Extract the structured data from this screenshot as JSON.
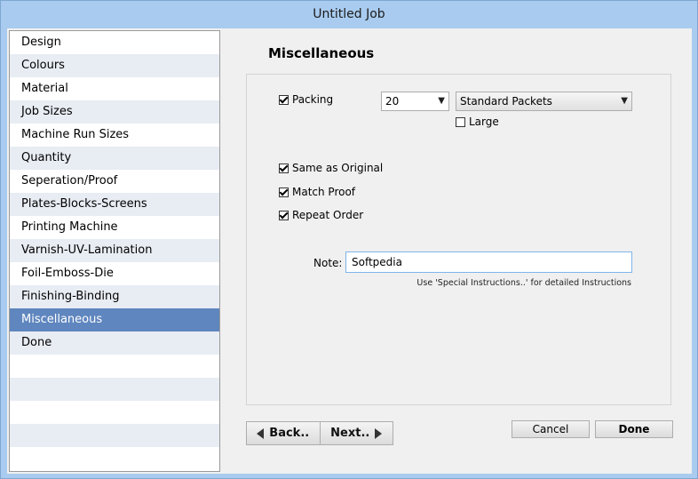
{
  "window": {
    "title": "Untitled Job"
  },
  "sidebar": {
    "items": [
      {
        "label": "Design"
      },
      {
        "label": "Colours"
      },
      {
        "label": "Material"
      },
      {
        "label": "Job Sizes"
      },
      {
        "label": "Machine Run Sizes"
      },
      {
        "label": "Quantity"
      },
      {
        "label": "Seperation/Proof"
      },
      {
        "label": "Plates-Blocks-Screens"
      },
      {
        "label": "Printing Machine"
      },
      {
        "label": "Varnish-UV-Lamination"
      },
      {
        "label": "Foil-Emboss-Die"
      },
      {
        "label": "Finishing-Binding"
      },
      {
        "label": "Miscellaneous"
      },
      {
        "label": "Done"
      }
    ],
    "selected": "Miscellaneous"
  },
  "main": {
    "title": "Miscellaneous",
    "packing": {
      "label": "Packing",
      "checked": true,
      "count": "20",
      "type": "Standard Packets"
    },
    "large": {
      "label": "Large",
      "checked": false
    },
    "same_as_original": {
      "label": "Same as Original",
      "checked": true
    },
    "match_proof": {
      "label": "Match Proof",
      "checked": true
    },
    "repeat_order": {
      "label": "Repeat Order",
      "checked": true
    },
    "note": {
      "label": "Note:",
      "value": "Softpedia",
      "hint": "Use 'Special Instructions..' for detailed Instructions"
    }
  },
  "buttons": {
    "back": "Back..",
    "next": "Next..",
    "cancel": "Cancel",
    "done": "Done"
  }
}
